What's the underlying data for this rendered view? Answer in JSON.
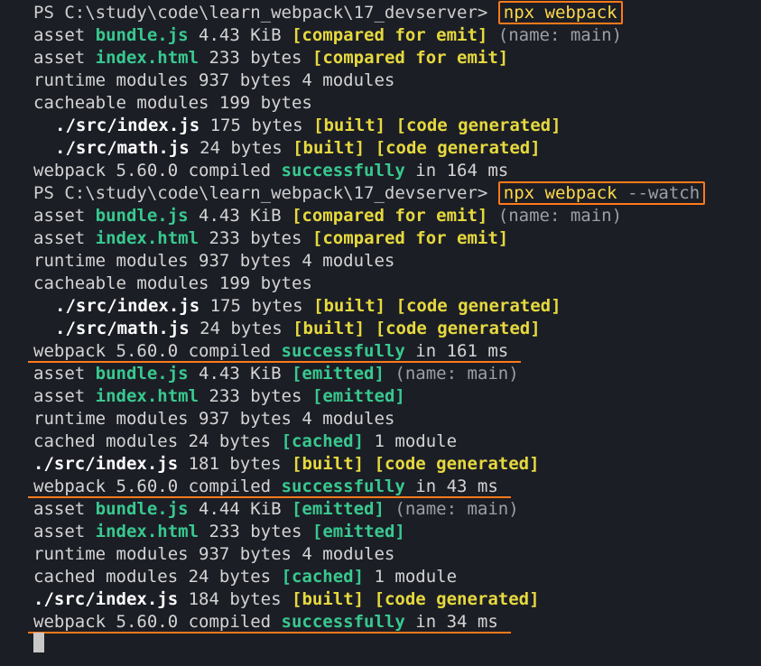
{
  "terminal": {
    "prompt": "PS C:\\study\\code\\learn_webpack\\17_devserver>",
    "command1": "npx webpack",
    "command2_cmd": "npx webpack",
    "command2_flag": "--watch",
    "run1": {
      "asset1": {
        "prefix": "asset ",
        "name": "bundle.js",
        "size": " 4.43 KiB ",
        "tag": "[compared for emit]",
        "suffix": " (name: main)"
      },
      "asset2": {
        "prefix": "asset ",
        "name": "index.html",
        "size": " 233 bytes ",
        "tag": "[compared for emit]"
      },
      "runtime": "runtime modules 937 bytes 4 modules",
      "cacheable": "cacheable modules 199 bytes",
      "mod1": {
        "name": "./src/index.js",
        "size": " 175 bytes ",
        "built": "[built]",
        "gen": " [code generated]"
      },
      "mod2": {
        "name": "./src/math.js",
        "size": " 24 bytes ",
        "built": "[built]",
        "gen": " [code generated]"
      },
      "compiled": {
        "pre": "webpack 5.60.0 compiled ",
        "status": "successfully",
        "post": " in 164 ms"
      }
    },
    "run2": {
      "asset1": {
        "prefix": "asset ",
        "name": "bundle.js",
        "size": " 4.43 KiB ",
        "tag": "[compared for emit]",
        "suffix": " (name: main)"
      },
      "asset2": {
        "prefix": "asset ",
        "name": "index.html",
        "size": " 233 bytes ",
        "tag": "[compared for emit]"
      },
      "runtime": "runtime modules 937 bytes 4 modules",
      "cacheable": "cacheable modules 199 bytes",
      "mod1": {
        "name": "./src/index.js",
        "size": " 175 bytes ",
        "built": "[built]",
        "gen": " [code generated]"
      },
      "mod2": {
        "name": "./src/math.js",
        "size": " 24 bytes ",
        "built": "[built]",
        "gen": " [code generated]"
      },
      "compiled": {
        "pre": "webpack 5.60.0 compiled ",
        "status": "successfully",
        "post": " in 161 ms"
      }
    },
    "run3": {
      "asset1": {
        "prefix": "asset ",
        "name": "bundle.js",
        "size": " 4.43 KiB ",
        "tag": "[emitted]",
        "suffix": " (name: main)"
      },
      "asset2": {
        "prefix": "asset ",
        "name": "index.html",
        "size": " 233 bytes ",
        "tag": "[emitted]"
      },
      "runtime": "runtime modules 937 bytes 4 modules",
      "cached": {
        "pre": "cached modules 24 bytes ",
        "tag": "[cached]",
        "post": " 1 module"
      },
      "mod1": {
        "name": "./src/index.js",
        "size": " 181 bytes ",
        "built": "[built]",
        "gen": " [code generated]"
      },
      "compiled": {
        "pre": "webpack 5.60.0 compiled ",
        "status": "successfully",
        "post": " in 43 ms"
      }
    },
    "run4": {
      "asset1": {
        "prefix": "asset ",
        "name": "bundle.js",
        "size": " 4.44 KiB ",
        "tag": "[emitted]",
        "suffix": " (name: main)"
      },
      "asset2": {
        "prefix": "asset ",
        "name": "index.html",
        "size": " 233 bytes ",
        "tag": "[emitted]"
      },
      "runtime": "runtime modules 937 bytes 4 modules",
      "cached": {
        "pre": "cached modules 24 bytes ",
        "tag": "[cached]",
        "post": " 1 module"
      },
      "mod1": {
        "name": "./src/index.js",
        "size": " 184 bytes ",
        "built": "[built]",
        "gen": " [code generated]"
      },
      "compiled": {
        "pre": "webpack 5.60.0 compiled ",
        "status": "successfully",
        "post": " in 34 ms"
      }
    },
    "colors": {
      "background": "#1c1e26",
      "green": "#38c98f",
      "yellow": "#e6d93e",
      "highlight": "#ff7a1a"
    }
  }
}
